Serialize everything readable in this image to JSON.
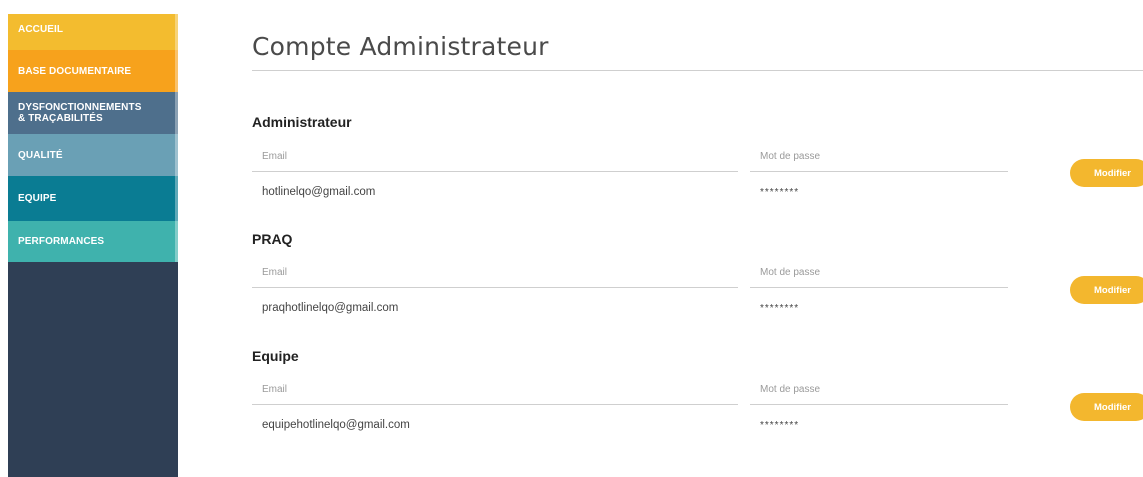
{
  "sidebar": {
    "items": [
      {
        "label": "ACCUEIL"
      },
      {
        "label": "BASE DOCUMENTAIRE"
      },
      {
        "label": "DYSFONCTIONNEMENTS\n& TRAÇABILITÉS"
      },
      {
        "label": "QUALITÉ"
      },
      {
        "label": "EQUIPE"
      },
      {
        "label": "PERFORMANCES"
      }
    ]
  },
  "page": {
    "title": "Compte Administrateur"
  },
  "accounts": [
    {
      "title": "Administrateur",
      "email_label": "Email",
      "email": "hotlinelqo@gmail.com",
      "password_label": "Mot de passe",
      "password": "********",
      "button": "Modifier"
    },
    {
      "title": "PRAQ",
      "email_label": "Email",
      "email": "praqhotlinelqo@gmail.com",
      "password_label": "Mot de passe",
      "password": "********",
      "button": "Modifier"
    },
    {
      "title": "Equipe",
      "email_label": "Email",
      "email": "equipehotlinelqo@gmail.com",
      "password_label": "Mot de passe",
      "password": "********",
      "button": "Modifier"
    }
  ],
  "colors": {
    "accent": "#f3b72e",
    "sidebar_bg": "#2f3f55"
  }
}
